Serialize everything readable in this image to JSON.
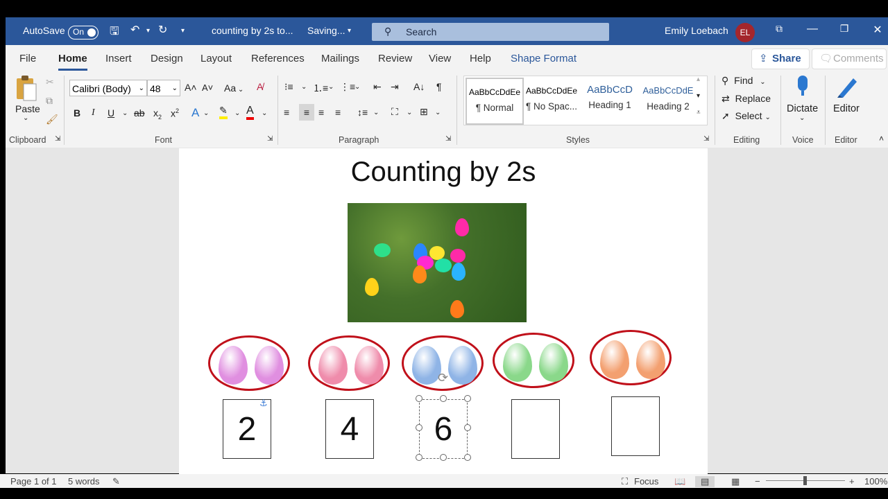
{
  "titlebar": {
    "autosave_label": "AutoSave",
    "autosave_state": "On",
    "doc_title": "counting by 2s to...",
    "save_status": "Saving...",
    "search_placeholder": "Search",
    "user_name": "Emily Loebach",
    "user_initials": "EL"
  },
  "menu": {
    "tabs": [
      "File",
      "Home",
      "Insert",
      "Design",
      "Layout",
      "References",
      "Mailings",
      "Review",
      "View",
      "Help",
      "Shape Format"
    ],
    "active_tab": "Home",
    "share_label": "Share",
    "comments_label": "Comments"
  },
  "ribbon": {
    "clipboard": {
      "paste_label": "Paste",
      "group_label": "Clipboard"
    },
    "font": {
      "font_name": "Calibri (Body)",
      "font_size": "48",
      "group_label": "Font",
      "case_label": "Aa"
    },
    "paragraph": {
      "group_label": "Paragraph"
    },
    "styles": {
      "group_label": "Styles",
      "items": [
        {
          "preview": "AaBbCcDdEe",
          "name": "¶ Normal"
        },
        {
          "preview": "AaBbCcDdEe",
          "name": "¶ No Spac..."
        },
        {
          "preview": "AaBbCcD",
          "name": "Heading 1"
        },
        {
          "preview": "AaBbCcDdE",
          "name": "Heading 2"
        }
      ]
    },
    "editing": {
      "find_label": "Find",
      "replace_label": "Replace",
      "select_label": "Select",
      "group_label": "Editing"
    },
    "voice": {
      "dictate_label": "Dictate",
      "group_label": "Voice"
    },
    "editor": {
      "editor_label": "Editor",
      "group_label": "Editor"
    }
  },
  "document": {
    "title": "Counting by 2s",
    "egg_groups": [
      {
        "color": "#e08fe0",
        "number": "2"
      },
      {
        "color": "#ef8cab",
        "number": "4"
      },
      {
        "color": "#8fb4e6",
        "number": "6"
      },
      {
        "color": "#8ad88a",
        "number": ""
      },
      {
        "color": "#f3a070",
        "number": ""
      }
    ]
  },
  "statusbar": {
    "page": "Page 1 of 1",
    "words": "5 words",
    "focus": "Focus",
    "zoom": "100%"
  },
  "colors": {
    "word_blue": "#2b579a",
    "oval_red": "#c0101a",
    "avatar": "#a4262c"
  }
}
